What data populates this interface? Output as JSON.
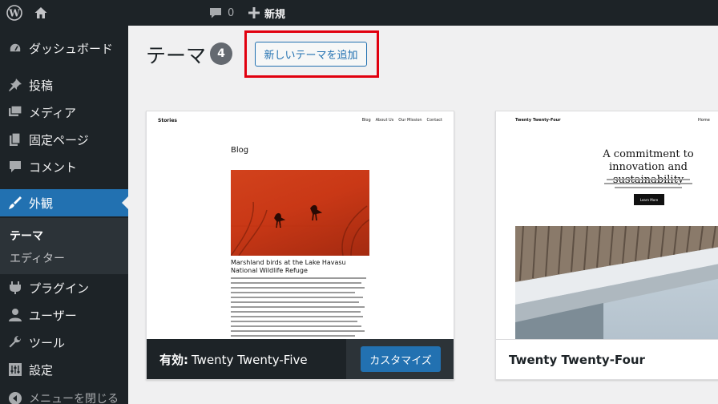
{
  "adminbar": {
    "comments_count": "0",
    "new_label": "新規"
  },
  "sidebar": {
    "items": [
      {
        "label": "ダッシュボード",
        "icon": "dashboard-icon"
      },
      {
        "label": "投稿",
        "icon": "pin-icon"
      },
      {
        "label": "メディア",
        "icon": "media-icon"
      },
      {
        "label": "固定ページ",
        "icon": "page-icon"
      },
      {
        "label": "コメント",
        "icon": "comment-icon"
      },
      {
        "label": "外観",
        "icon": "brush-icon"
      },
      {
        "label": "プラグイン",
        "icon": "plugin-icon"
      },
      {
        "label": "ユーザー",
        "icon": "user-icon"
      },
      {
        "label": "ツール",
        "icon": "wrench-icon"
      },
      {
        "label": "設定",
        "icon": "settings-icon"
      }
    ],
    "submenu": [
      {
        "label": "テーマ"
      },
      {
        "label": "エディター"
      }
    ],
    "collapse_label": "メニューを閉じる"
  },
  "main": {
    "title": "テーマ",
    "count": "4",
    "add_new_label": "新しいテーマを追加",
    "themes": [
      {
        "active_label": "有効:",
        "name": "Twenty Twenty-Five",
        "customize_label": "カスタマイズ",
        "preview": {
          "site_title": "Stories",
          "nav": [
            "Blog",
            "About Us",
            "Our Mission",
            "Contact"
          ],
          "heading": "Blog",
          "post_title": "Marshland birds at the Lake Havasu National Wildlife Refuge"
        }
      },
      {
        "name": "Twenty Twenty-Four",
        "preview": {
          "site_title": "Twenty Twenty-Four",
          "nav": "Home",
          "heading": "A commitment to innovation and sustainability",
          "button": "Learn More"
        }
      }
    ]
  },
  "colors": {
    "adminbar_bg": "#1d2327",
    "accent": "#2271b1",
    "highlight": "#e1000f"
  }
}
